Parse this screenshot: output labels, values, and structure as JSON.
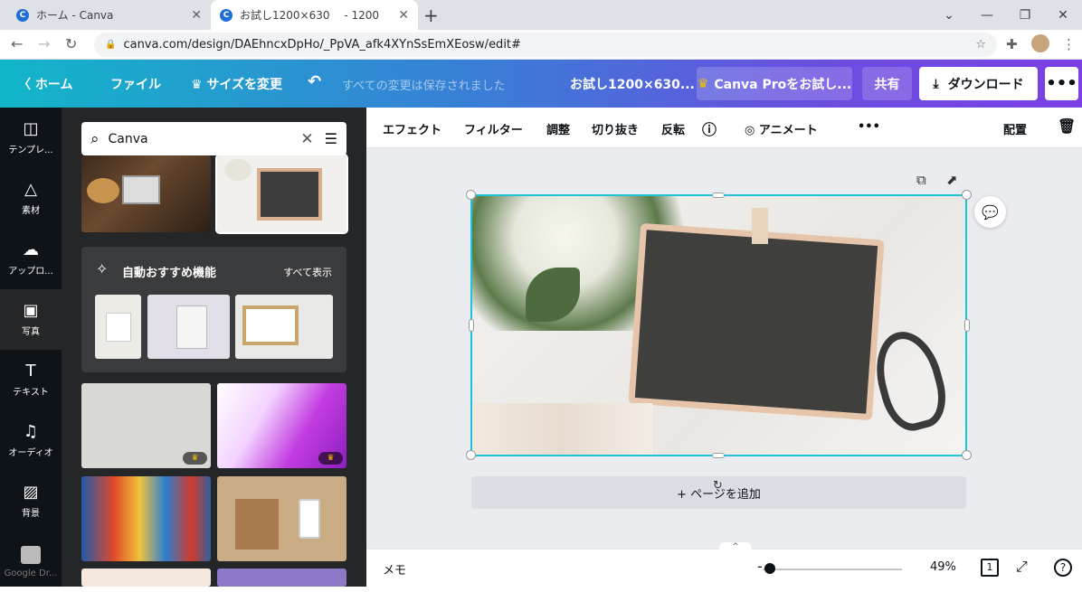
{
  "browser": {
    "tabs": [
      {
        "title": "ホーム - Canva",
        "favicon": "C"
      },
      {
        "title": "お試し1200×630　 - 1200",
        "favicon": "C"
      }
    ],
    "url": "canva.com/design/DAEhncxDpHo/_PpVA_afk4XYnSsEmXEosw/edit#"
  },
  "header": {
    "home": "ホーム",
    "file": "ファイル",
    "resize": "サイズを変更",
    "saved": "すべての変更は保存されました",
    "doc_title": "お試し1200×630...",
    "pro": "Canva Proをお試し...",
    "share": "共有",
    "download": "ダウンロード",
    "brand_gradient": [
      "#12b6c9",
      "#7b3fe4"
    ]
  },
  "rail": [
    {
      "label": "テンプレ...",
      "icon": "template-icon"
    },
    {
      "label": "素材",
      "icon": "elements-icon"
    },
    {
      "label": "アップロ...",
      "icon": "upload-icon"
    },
    {
      "label": "写真",
      "icon": "photo-icon"
    },
    {
      "label": "テキスト",
      "icon": "text-icon"
    },
    {
      "label": "オーディオ",
      "icon": "audio-icon"
    },
    {
      "label": "背景",
      "icon": "background-icon"
    },
    {
      "label": "Google Dr...",
      "icon": "google-drive-icon"
    }
  ],
  "panel": {
    "search_value": "Canva",
    "suggest_title": "自動おすすめ機能",
    "suggest_all": "すべて表示"
  },
  "toolbar": {
    "effect": "エフェクト",
    "filter": "フィルター",
    "adjust": "調整",
    "crop": "切り抜き",
    "flip": "反転",
    "animate": "アニメート",
    "position": "配置"
  },
  "canvas": {
    "add_page": "+ ページを追加"
  },
  "footer": {
    "notes": "メモ",
    "zoom": "49%",
    "page_count": "1"
  }
}
